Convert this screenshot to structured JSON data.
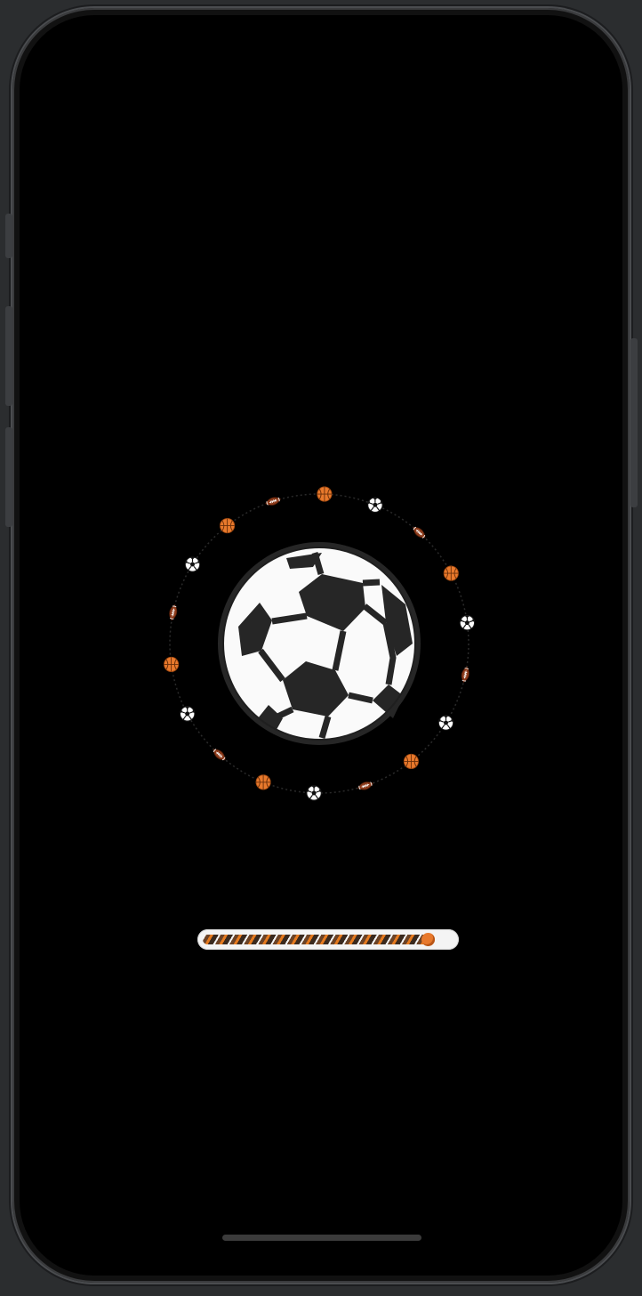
{
  "app": {
    "screen": "loading"
  },
  "loader": {
    "center_icon": "soccer-ball-icon",
    "orbit_icons": [
      "basketball-icon",
      "soccer-ball-icon",
      "football-icon",
      "basketball-icon",
      "soccer-ball-icon",
      "football-icon",
      "soccer-ball-icon",
      "basketball-icon",
      "football-icon",
      "soccer-ball-icon",
      "basketball-icon",
      "football-icon",
      "soccer-ball-icon",
      "basketball-icon",
      "football-icon",
      "soccer-ball-icon",
      "basketball-icon",
      "football-icon"
    ]
  },
  "progress": {
    "value": 0.9
  },
  "colors": {
    "background": "#000000",
    "accent": "#e8792c",
    "football": "#8b3a1a",
    "track": "#f4f4f4"
  }
}
